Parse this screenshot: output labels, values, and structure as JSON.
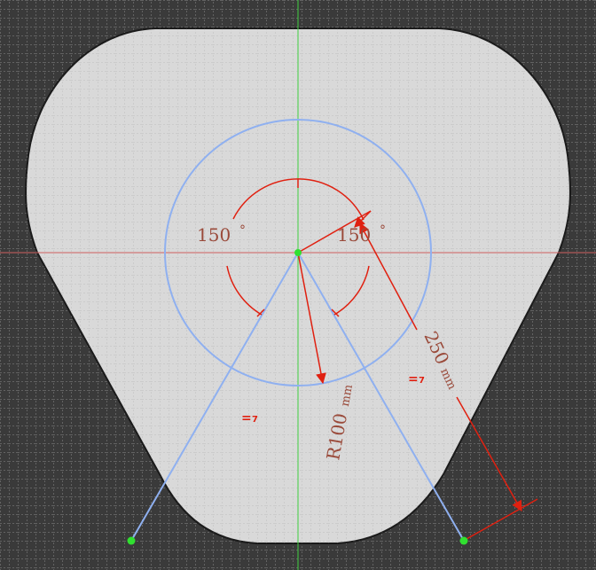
{
  "colors": {
    "background": "#3a3a3a",
    "grid": "#8a8a8a",
    "part_fill": "#d9d9d9",
    "part_edge": "#1a1a1a",
    "construction": "#8fb0f0",
    "dimension": "#e02010",
    "dimension_text": "#9a4a3a",
    "axis_horizontal": "#d06060",
    "axis_vertical": "#40d040",
    "point": "#30e030"
  },
  "dimensions": {
    "angle_left": {
      "value": "150",
      "unit": "°"
    },
    "angle_right": {
      "value": "150",
      "unit": "°"
    },
    "radius": {
      "value": "R100",
      "unit": "mm"
    },
    "length": {
      "value": "250",
      "unit": "mm"
    }
  },
  "constraints": {
    "equal_left": "=",
    "equal_left_index": "7",
    "equal_right": "=",
    "equal_right_index": "7"
  },
  "icons": {
    "origin_point": "green-dot",
    "end_points": "green-dot",
    "constraint": "equal-constraint-icon"
  }
}
